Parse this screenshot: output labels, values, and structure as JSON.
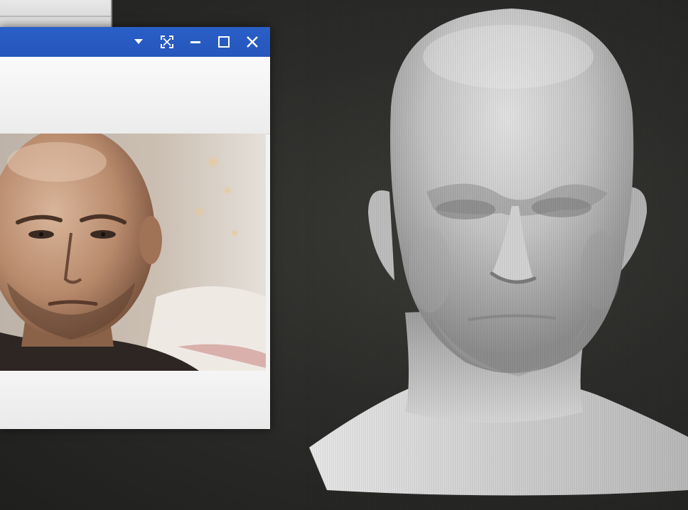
{
  "reference_window": {
    "controls": {
      "dropdown": "chevron-down-icon",
      "fit": "fit-to-screen-icon",
      "minimize": "minimize-icon",
      "maximize": "maximize-icon",
      "close": "close-icon"
    },
    "image": "reference-photo-bald-man"
  },
  "viewport": {
    "model": "3d-head-sculpt"
  },
  "colors": {
    "titlebar": "#2a5fc8",
    "window_bg": "#f3f3f3",
    "viewport_bg": "#2c2c2a",
    "model_base": "#c8c8c8"
  }
}
